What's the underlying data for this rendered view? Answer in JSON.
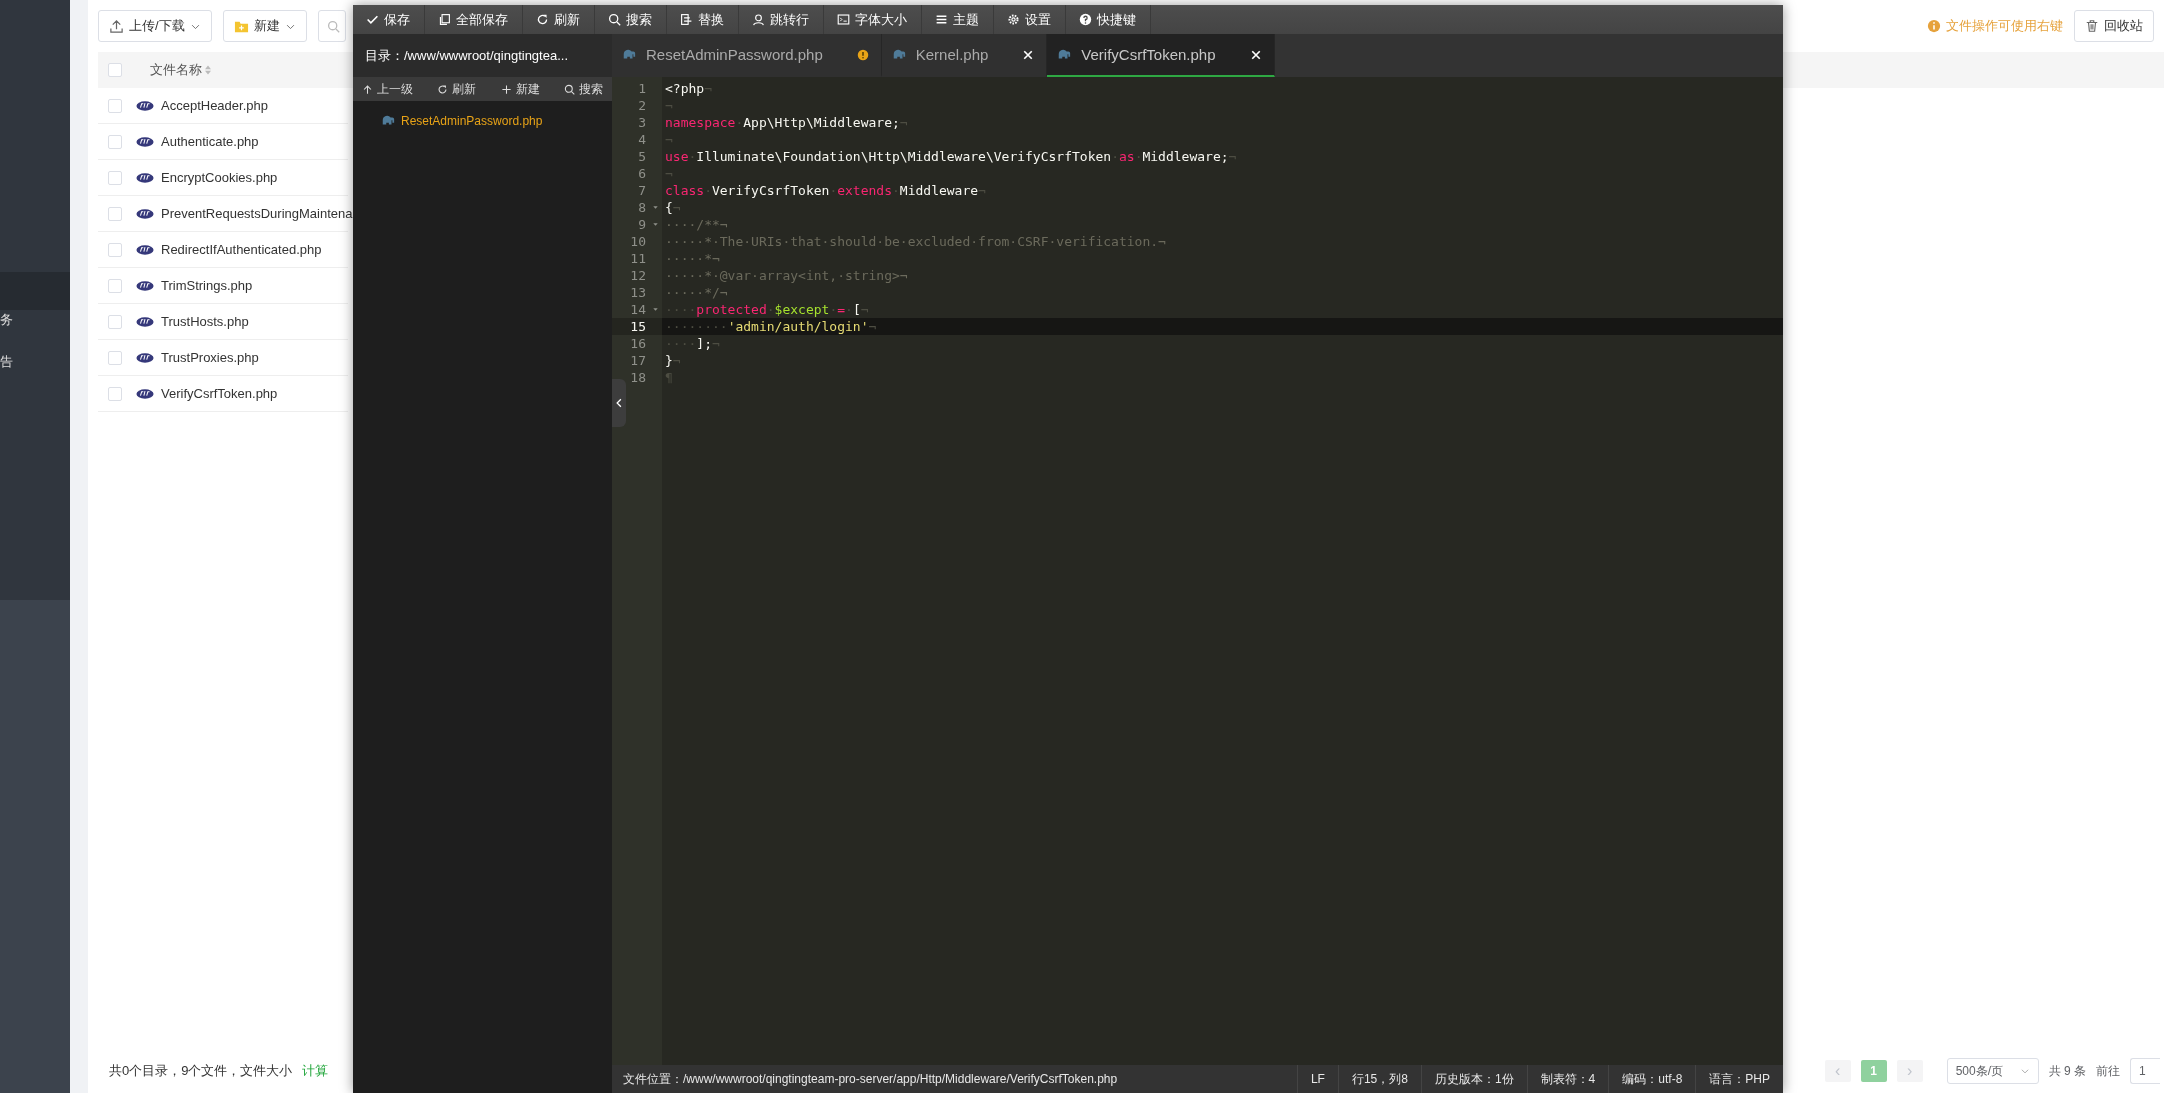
{
  "sidebar": {
    "items": [
      {
        "label": "务"
      },
      {
        "label": "告"
      }
    ]
  },
  "file_manager": {
    "toolbar": {
      "upload_button": "上传/下载",
      "new_button": "新建",
      "notice": "文件操作可使用右键",
      "recycle_button": "回收站"
    },
    "table": {
      "columns": [
        "文件名称"
      ],
      "select_all_checked": false,
      "rows": [
        {
          "name": "AcceptHeader.php",
          "checked": false
        },
        {
          "name": "Authenticate.php",
          "checked": false
        },
        {
          "name": "EncryptCookies.php",
          "checked": false
        },
        {
          "name": "PreventRequestsDuringMaintena",
          "checked": false
        },
        {
          "name": "RedirectIfAuthenticated.php",
          "checked": false
        },
        {
          "name": "TrimStrings.php",
          "checked": false
        },
        {
          "name": "TrustHosts.php",
          "checked": false
        },
        {
          "name": "TrustProxies.php",
          "checked": false
        },
        {
          "name": "VerifyCsrfToken.php",
          "checked": false
        }
      ]
    },
    "footer": {
      "summary": "共0个目录，9个文件，文件大小",
      "compute_link": "计算"
    },
    "pagination": {
      "prev": "‹",
      "pages": [
        {
          "label": "1",
          "selected": true
        }
      ],
      "next": "›",
      "page_size": "500条/页",
      "total": "共 9 条",
      "goto_label": "前往",
      "goto_value": "1"
    }
  },
  "editor": {
    "toolbar": [
      {
        "label": "保存"
      },
      {
        "label": "全部保存"
      },
      {
        "label": "刷新"
      },
      {
        "label": "搜索"
      },
      {
        "label": "替换"
      },
      {
        "label": "跳转行"
      },
      {
        "label": "字体大小"
      },
      {
        "label": "主题"
      },
      {
        "label": "设置"
      },
      {
        "label": "快捷键"
      }
    ],
    "directory": "目录：/www/wwwroot/qingtingtea...",
    "tree_actions": [
      {
        "label": "上一级"
      },
      {
        "label": "刷新"
      },
      {
        "label": "新建"
      },
      {
        "label": "搜索"
      }
    ],
    "tree": [
      {
        "name": "ResetAdminPassword.php"
      }
    ],
    "tabs": [
      {
        "label": "ResetAdminPassword.php",
        "selected": false,
        "modified": true
      },
      {
        "label": "Kernel.php",
        "selected": false,
        "modified": false
      },
      {
        "label": "VerifyCsrfToken.php",
        "selected": true,
        "modified": false
      }
    ],
    "lines": [
      {
        "number": "1",
        "fold": false,
        "active": false,
        "tokens": [
          {
            "kind": "plain",
            "text": "<?php"
          },
          {
            "kind": "ws",
            "text": "¬"
          }
        ]
      },
      {
        "number": "2",
        "fold": false,
        "active": false,
        "tokens": [
          {
            "kind": "ws",
            "text": "¬"
          }
        ]
      },
      {
        "number": "3",
        "fold": false,
        "active": false,
        "tokens": [
          {
            "kind": "kw",
            "text": "namespace"
          },
          {
            "kind": "ws",
            "text": "·"
          },
          {
            "kind": "plain",
            "text": "App\\Http\\Middleware;"
          },
          {
            "kind": "ws",
            "text": "¬"
          }
        ]
      },
      {
        "number": "4",
        "fold": false,
        "active": false,
        "tokens": [
          {
            "kind": "ws",
            "text": "¬"
          }
        ]
      },
      {
        "number": "5",
        "fold": false,
        "active": false,
        "tokens": [
          {
            "kind": "kw",
            "text": "use"
          },
          {
            "kind": "ws",
            "text": "·"
          },
          {
            "kind": "plain",
            "text": "Illuminate\\Foundation\\Http\\Middleware\\VerifyCsrfToken"
          },
          {
            "kind": "ws",
            "text": "·"
          },
          {
            "kind": "kw",
            "text": "as"
          },
          {
            "kind": "ws",
            "text": "·"
          },
          {
            "kind": "plain",
            "text": "Middleware;"
          },
          {
            "kind": "ws",
            "text": "¬"
          }
        ]
      },
      {
        "number": "6",
        "fold": false,
        "active": false,
        "tokens": [
          {
            "kind": "ws",
            "text": "¬"
          }
        ]
      },
      {
        "number": "7",
        "fold": false,
        "active": false,
        "tokens": [
          {
            "kind": "kw",
            "text": "class"
          },
          {
            "kind": "ws",
            "text": "·"
          },
          {
            "kind": "plain",
            "text": "VerifyCsrfToken"
          },
          {
            "kind": "ws",
            "text": "·"
          },
          {
            "kind": "kw",
            "text": "extends"
          },
          {
            "kind": "ws",
            "text": "·"
          },
          {
            "kind": "plain",
            "text": "Middleware"
          },
          {
            "kind": "ws",
            "text": "¬"
          }
        ]
      },
      {
        "number": "8",
        "fold": true,
        "active": false,
        "tokens": [
          {
            "kind": "plain",
            "text": "{"
          },
          {
            "kind": "ws",
            "text": "¬"
          }
        ]
      },
      {
        "number": "9",
        "fold": true,
        "active": false,
        "tokens": [
          {
            "kind": "comment",
            "text": "····/**¬"
          }
        ]
      },
      {
        "number": "10",
        "fold": false,
        "active": false,
        "tokens": [
          {
            "kind": "comment",
            "text": "·····*·The·URIs·that·should·be·excluded·from·CSRF·verification.¬"
          }
        ]
      },
      {
        "number": "11",
        "fold": false,
        "active": false,
        "tokens": [
          {
            "kind": "comment",
            "text": "·····*¬"
          }
        ]
      },
      {
        "number": "12",
        "fold": false,
        "active": false,
        "tokens": [
          {
            "kind": "comment",
            "text": "·····*·@var·array<int,·string>¬"
          }
        ]
      },
      {
        "number": "13",
        "fold": false,
        "active": false,
        "tokens": [
          {
            "kind": "comment",
            "text": "·····*/¬"
          }
        ]
      },
      {
        "number": "14",
        "fold": true,
        "active": false,
        "tokens": [
          {
            "kind": "ws",
            "text": "····"
          },
          {
            "kind": "kw",
            "text": "protected"
          },
          {
            "kind": "ws",
            "text": "·"
          },
          {
            "kind": "var",
            "text": "$except"
          },
          {
            "kind": "ws",
            "text": "·"
          },
          {
            "kind": "kw",
            "text": "="
          },
          {
            "kind": "ws",
            "text": "·"
          },
          {
            "kind": "plain",
            "text": "["
          },
          {
            "kind": "ws",
            "text": "¬"
          }
        ]
      },
      {
        "number": "15",
        "fold": false,
        "active": true,
        "tokens": [
          {
            "kind": "ws",
            "text": "········"
          },
          {
            "kind": "string",
            "text": "'admin/auth/login'"
          },
          {
            "kind": "ws",
            "text": "¬"
          }
        ]
      },
      {
        "number": "16",
        "fold": false,
        "active": false,
        "tokens": [
          {
            "kind": "ws",
            "text": "····"
          },
          {
            "kind": "plain",
            "text": "];"
          },
          {
            "kind": "ws",
            "text": "¬"
          }
        ]
      },
      {
        "number": "17",
        "fold": false,
        "active": false,
        "tokens": [
          {
            "kind": "plain",
            "text": "}"
          },
          {
            "kind": "ws",
            "text": "¬"
          }
        ]
      },
      {
        "number": "18",
        "fold": false,
        "active": false,
        "tokens": [
          {
            "kind": "ws",
            "text": "¶"
          }
        ]
      }
    ],
    "status_bar": {
      "path": "文件位置：/www/wwwroot/qingtingteam-pro-server/app/Http/Middleware/VerifyCsrfToken.php",
      "items": [
        "LF",
        "行15，列8",
        "历史版本：1份",
        "制表符：4",
        "编码：utf-8",
        "语言：PHP"
      ]
    }
  }
}
